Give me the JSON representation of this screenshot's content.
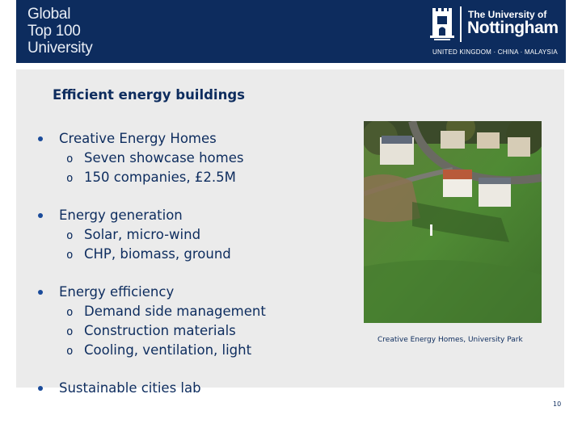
{
  "header": {
    "badge_lines": [
      "Global",
      "Top 100",
      "University"
    ],
    "university_small": "The University of",
    "university_big": "Nottingham",
    "campuses": "UNITED KINGDOM · CHINA · MALAYSIA"
  },
  "slide": {
    "title": "Efficient energy buildings",
    "bullets": [
      {
        "text": "Creative Energy Homes",
        "subs": [
          "Seven showcase homes",
          "150 companies, £2.5M"
        ]
      },
      {
        "text": "Energy generation",
        "subs": [
          "Solar, micro-wind",
          "CHP, biomass, ground"
        ]
      },
      {
        "text": "Energy efficiency",
        "subs": [
          "Demand side management",
          "Construction materials",
          "Cooling, ventilation, light"
        ]
      },
      {
        "text": "Sustainable cities lab",
        "subs": []
      }
    ],
    "sub_marker": "o",
    "photo_caption": "Creative Energy Homes, University Park",
    "page_number": "10"
  },
  "colors": {
    "brand_navy": "#0d2c5e",
    "content_bg": "#ebebeb"
  },
  "icons": [
    "university-crest-icon"
  ]
}
